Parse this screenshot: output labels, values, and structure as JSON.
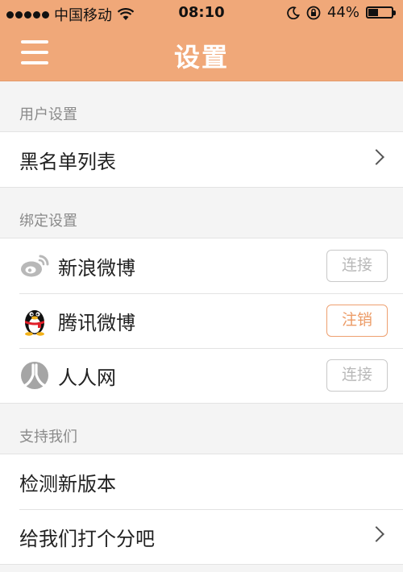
{
  "status_bar": {
    "carrier": "中国移动",
    "time": "08:10",
    "battery": "44%",
    "battery_level": 0.44
  },
  "nav": {
    "title": "设置"
  },
  "sections": {
    "user": {
      "header": "用户设置",
      "items": [
        {
          "label": "黑名单列表"
        }
      ]
    },
    "binding": {
      "header": "绑定设置",
      "items": [
        {
          "label": "新浪微博",
          "button": "连接",
          "icon": "weibo-icon"
        },
        {
          "label": "腾讯微博",
          "button": "注销",
          "icon": "qq-penguin-icon"
        },
        {
          "label": "人人网",
          "button": "连接",
          "icon": "renren-icon"
        }
      ]
    },
    "support": {
      "header": "支持我们",
      "items": [
        {
          "label": "检测新版本"
        },
        {
          "label": "给我们打个分吧"
        }
      ]
    }
  },
  "colors": {
    "header_bg": "#f0a879",
    "accent": "#ec9b66",
    "disabled_text": "#b9b9b9"
  }
}
